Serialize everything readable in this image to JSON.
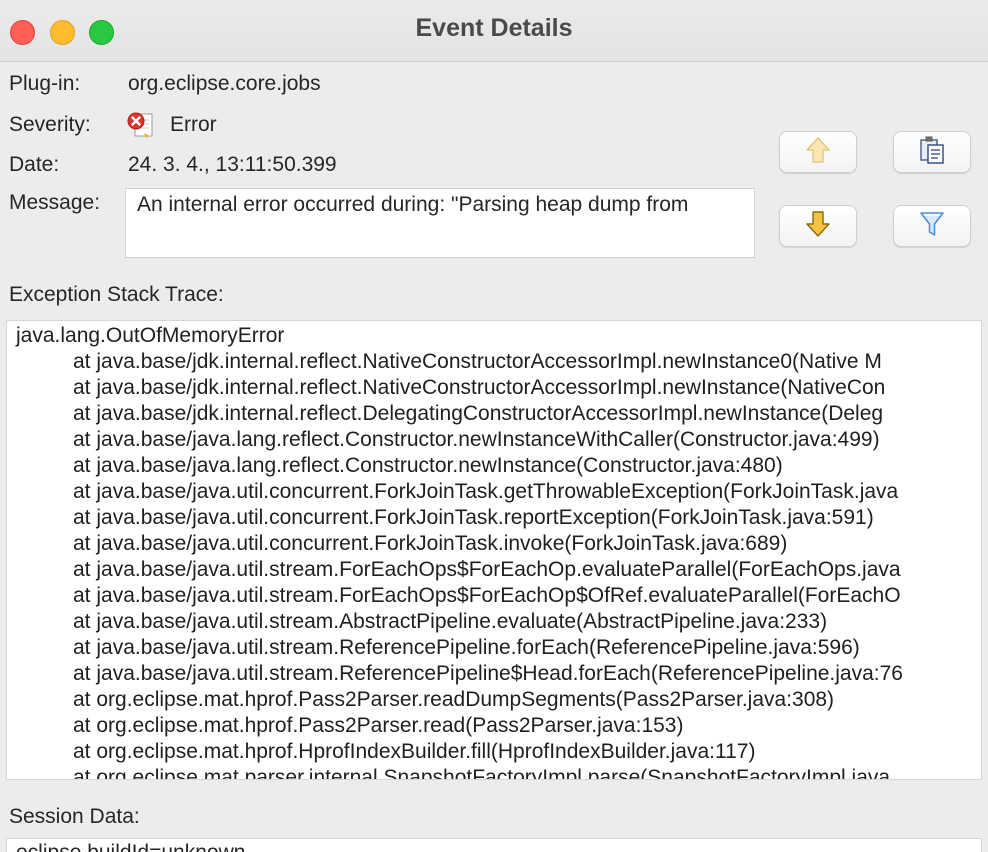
{
  "window": {
    "title": "Event Details"
  },
  "fields": {
    "plugin_label": "Plug-in:",
    "plugin_value": "org.eclipse.core.jobs",
    "severity_label": "Severity:",
    "severity_value": "Error",
    "date_label": "Date:",
    "date_value": "24. 3. 4., 13:11:50.399",
    "message_label": "Message:",
    "message_value": "An internal error occurred during: \"Parsing heap dump from"
  },
  "icons": {
    "severity": "error-icon",
    "previous": "arrow-up-icon",
    "next": "arrow-down-icon",
    "copy": "clipboard-icon",
    "filter": "filter-icon"
  },
  "colors": {
    "error_red": "#d9362e",
    "arrow_fill": "#f5c242",
    "filter_blue": "#4f8fd6"
  },
  "stack_trace": {
    "label": "Exception Stack Trace:",
    "lines": [
      "java.lang.OutOfMemoryError",
      "at java.base/jdk.internal.reflect.NativeConstructorAccessorImpl.newInstance0(Native M",
      "at java.base/jdk.internal.reflect.NativeConstructorAccessorImpl.newInstance(NativeCon",
      "at java.base/jdk.internal.reflect.DelegatingConstructorAccessorImpl.newInstance(Deleg",
      "at java.base/java.lang.reflect.Constructor.newInstanceWithCaller(Constructor.java:499)",
      "at java.base/java.lang.reflect.Constructor.newInstance(Constructor.java:480)",
      "at java.base/java.util.concurrent.ForkJoinTask.getThrowableException(ForkJoinTask.java",
      "at java.base/java.util.concurrent.ForkJoinTask.reportException(ForkJoinTask.java:591)",
      "at java.base/java.util.concurrent.ForkJoinTask.invoke(ForkJoinTask.java:689)",
      "at java.base/java.util.stream.ForEachOps$ForEachOp.evaluateParallel(ForEachOps.java",
      "at java.base/java.util.stream.ForEachOps$ForEachOp$OfRef.evaluateParallel(ForEachO",
      "at java.base/java.util.stream.AbstractPipeline.evaluate(AbstractPipeline.java:233)",
      "at java.base/java.util.stream.ReferencePipeline.forEach(ReferencePipeline.java:596)",
      "at java.base/java.util.stream.ReferencePipeline$Head.forEach(ReferencePipeline.java:76",
      "at org.eclipse.mat.hprof.Pass2Parser.readDumpSegments(Pass2Parser.java:308)",
      "at org.eclipse.mat.hprof.Pass2Parser.read(Pass2Parser.java:153)",
      "at org.eclipse.mat.hprof.HprofIndexBuilder.fill(HprofIndexBuilder.java:117)",
      "at org.eclipse.mat.parser.internal.SnapshotFactoryImpl.parse(SnapshotFactoryImpl.java"
    ]
  },
  "session": {
    "label": "Session Data:",
    "text": "eclipse.buildId=unknown"
  }
}
